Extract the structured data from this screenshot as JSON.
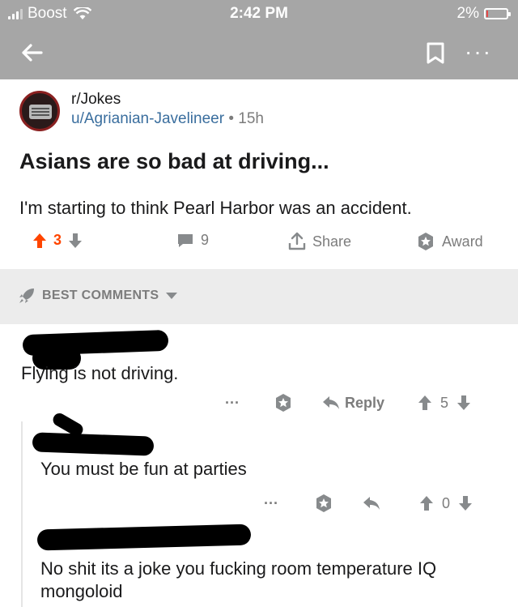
{
  "status_bar": {
    "carrier": "Boost",
    "time": "2:42 PM",
    "battery_percent": "2%",
    "battery_level": 0.02,
    "battery_color": "#e54b4b"
  },
  "nav": {
    "back_icon": "arrow-left-icon",
    "bookmark_icon": "bookmark-icon",
    "more_icon": "more-dots-icon",
    "more_label": "···"
  },
  "post": {
    "subreddit": "r/Jokes",
    "author": "u/Agrianian-Javelineer",
    "separator": "•",
    "age": "15h",
    "title": "Asians are so bad at driving...",
    "body": "I'm starting to think Pearl Harbor was an accident.",
    "upvote_count": "3",
    "comment_count": "9",
    "share_label": "Share",
    "award_label": "Award",
    "upvote_color": "#ff4500"
  },
  "sort": {
    "label": "BEST COMMENTS"
  },
  "comments": [
    {
      "text": "Flying is not driving.",
      "more_label": "···",
      "reply_label": "Reply",
      "score": "5"
    },
    {
      "text": "You must be fun at parties",
      "more_label": "···",
      "score": "0"
    },
    {
      "text": "No shit its a joke you fucking room temperature IQ mongoloid"
    }
  ]
}
